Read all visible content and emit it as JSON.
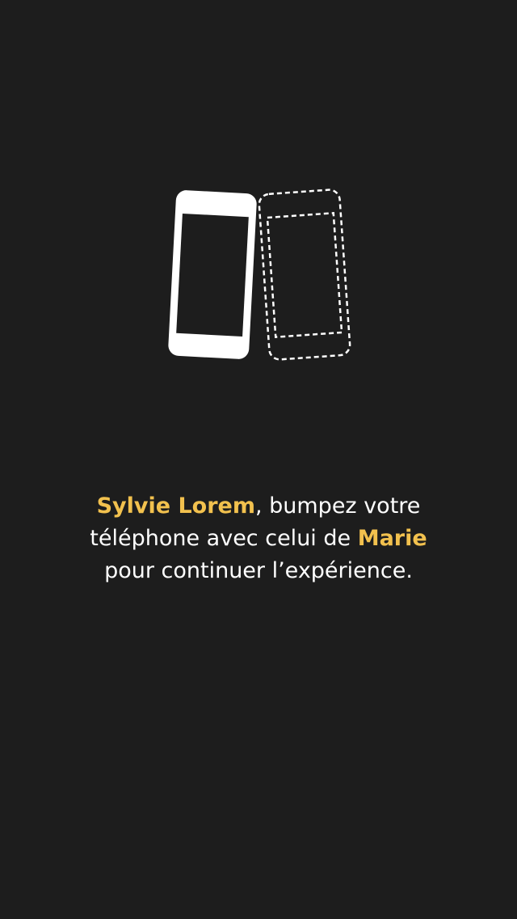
{
  "colors": {
    "background": "#1d1d1d",
    "text": "#ffffff",
    "accent": "#f2c14e"
  },
  "illustration": {
    "icon_name": "phone-bump-icon",
    "phone_solid_icon": "phone-icon",
    "phone_dashed_icon": "phone-outline-dashed-icon"
  },
  "message": {
    "line1": {
      "name": "Sylvie Lorem",
      "after_name": ", bumpez votre"
    },
    "line2": {
      "before_name": "téléphone avec celui de ",
      "name": "Marie"
    },
    "line3": {
      "text": "pour continuer l’expérience."
    }
  }
}
